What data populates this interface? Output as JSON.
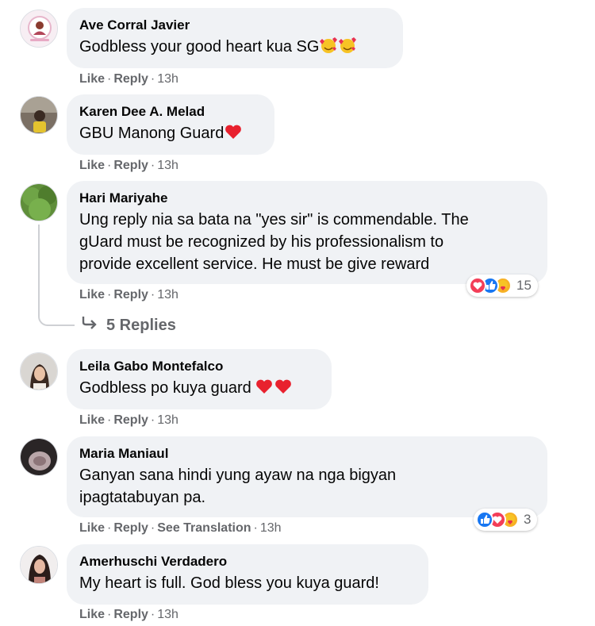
{
  "comments": [
    {
      "author": "Ave Corral Javier",
      "text": "Godbless your good heart kua SG",
      "actions": {
        "like": "Like",
        "reply": "Reply",
        "time": "13h"
      }
    },
    {
      "author": "Karen Dee A. Melad",
      "text": "GBU Manong Guard",
      "actions": {
        "like": "Like",
        "reply": "Reply",
        "time": "13h"
      }
    },
    {
      "author": "Hari Mariyahe",
      "text_lines": [
        "Ung reply nia sa bata na \"yes sir\" is commendable. The",
        "gUard must be recognized by his professionalism to",
        "provide excellent service. He must be give reward"
      ],
      "actions": {
        "like": "Like",
        "reply": "Reply",
        "time": "13h"
      },
      "reactions": {
        "icons": [
          "love",
          "like",
          "care"
        ],
        "count": "15"
      },
      "replies_label": "5 Replies"
    },
    {
      "author": "Leila Gabo Montefalco",
      "text": "Godbless po kuya guard",
      "actions": {
        "like": "Like",
        "reply": "Reply",
        "time": "13h"
      }
    },
    {
      "author": "Maria Maniaul",
      "text_lines": [
        "Ganyan sana hindi yung ayaw na nga bigyan",
        "ipagtatabuyan pa."
      ],
      "actions": {
        "like": "Like",
        "reply": "Reply",
        "see_translation": "See Translation",
        "time": "13h"
      },
      "reactions": {
        "icons": [
          "like",
          "love",
          "care"
        ],
        "count": "3"
      }
    },
    {
      "author": "Amerhuschi Verdadero",
      "text": "My heart is full. God bless you kuya guard!",
      "actions": {
        "like": "Like",
        "reply": "Reply",
        "time": "13h"
      }
    }
  ],
  "separator": "·",
  "colors": {
    "bubble": "#f0f2f5",
    "meta_text": "#65676b",
    "like_blue": "#1877f2",
    "love_red": "#f33e58",
    "care_yellow": "#f7b125"
  }
}
